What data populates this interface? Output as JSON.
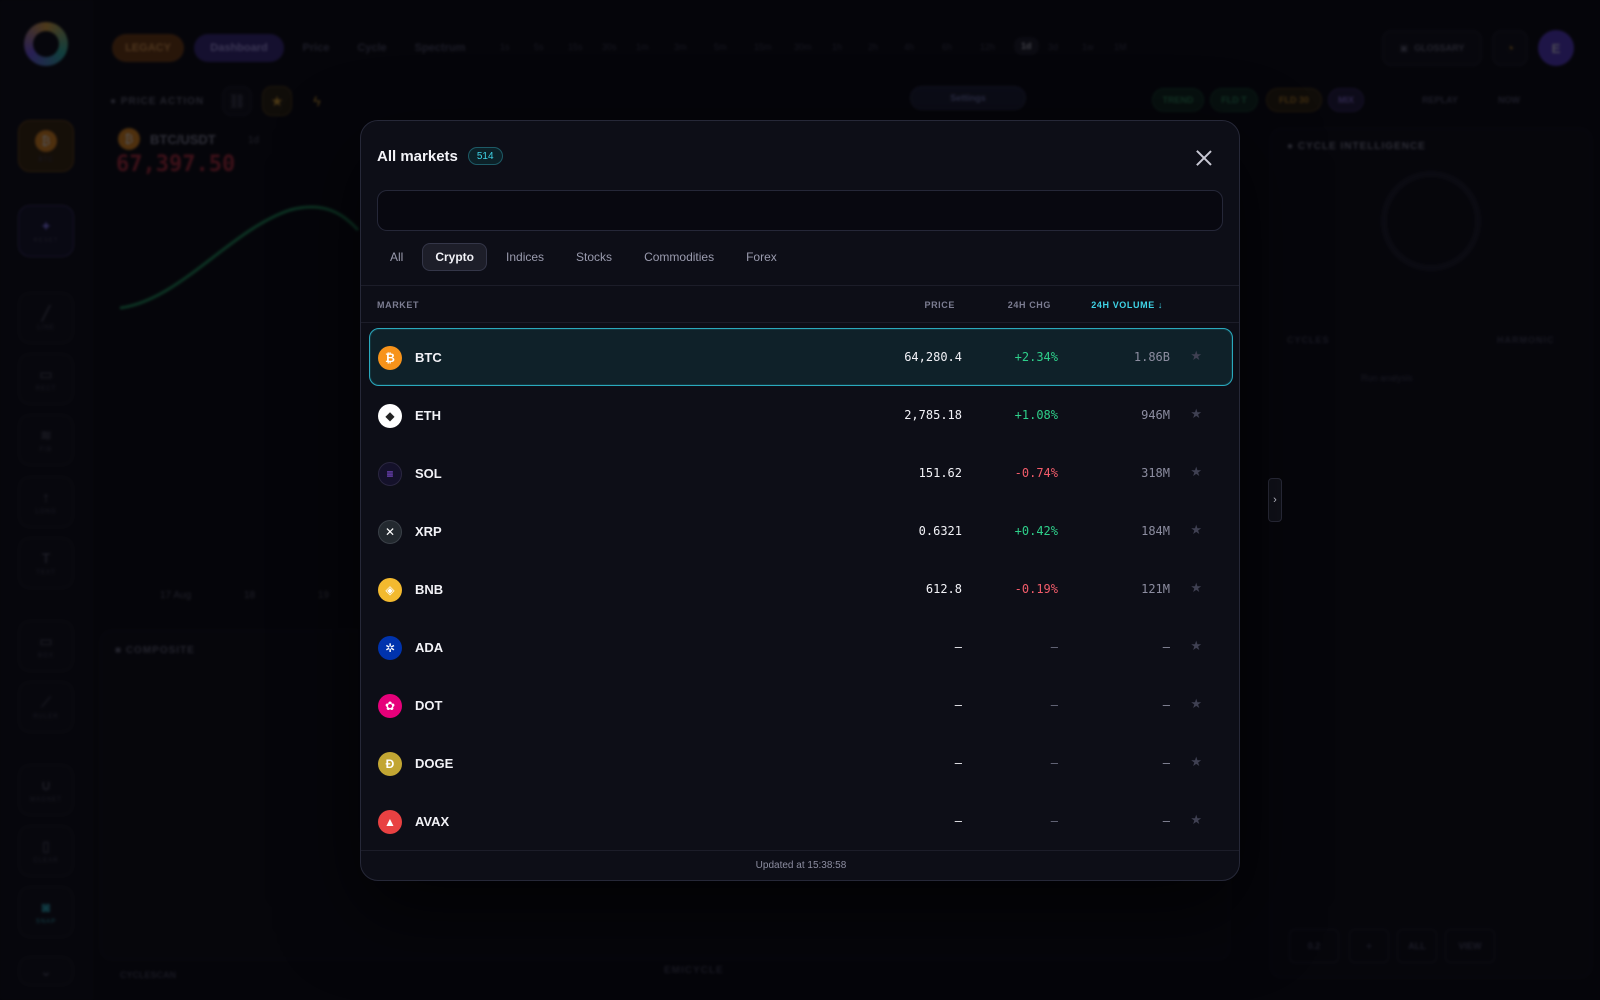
{
  "background": {
    "topbar": {
      "legacy_label": "LEGACY",
      "dashboard_label": "Dashboard",
      "nav": [
        "Price",
        "Cycle",
        "Spectrum"
      ],
      "timeframes": [
        "1s",
        "5s",
        "15s",
        "30s",
        "1m",
        "3m",
        "5m",
        "15m",
        "30m",
        "1h",
        "2h",
        "4h",
        "6h",
        "12h",
        "1d",
        "3d",
        "1w",
        "1M"
      ],
      "active_timeframe": "1d",
      "glossary_label": "GLOSSARY",
      "avatar_initial": "E"
    },
    "sidebar": {
      "btc_label": "BTC",
      "reset_label": "RESET",
      "items": [
        "LINE",
        "RECT",
        "FIB",
        "LONG",
        "TEXT",
        "BOX",
        "RULER",
        "MAGNET",
        "CLEAR",
        "SNAP"
      ]
    },
    "chart": {
      "section_title": "PRICE ACTION",
      "pair": "BTC/USDT",
      "interval": "1d",
      "price": "67,397.50",
      "xticks": [
        "17 Aug",
        "18",
        "19"
      ]
    },
    "toolbar": {
      "settings_label": "Settings",
      "trend_label": "TREND",
      "fld_t_label": "FLD T",
      "fld_30_label": "FLD 30",
      "mix_label": "MIX",
      "replay_label": "REPLAY",
      "now_label": "NOW"
    },
    "composite_title": "COMPOSITE",
    "cycle_intel_title": "CYCLE INTELLIGENCE",
    "cycles_label": "CYCLES",
    "harmonic_label": "HARMONIC",
    "run_analysis_label": "Run analysis",
    "cyclescan_label": "CYCLESCAN",
    "emicycle_label": "EMICYCLE",
    "bottom_buttons": [
      "0.2",
      "+",
      "ALL",
      "VIEW"
    ]
  },
  "modal": {
    "title": "All markets",
    "count": "514",
    "search_placeholder": "",
    "search_value": "",
    "tabs": [
      "All",
      "Crypto",
      "Indices",
      "Stocks",
      "Commodities",
      "Forex"
    ],
    "active_tab": "Crypto",
    "columns": {
      "market": "MARKET",
      "price": "PRICE",
      "change": "24H CHG",
      "volume": "24H VOLUME ↓"
    },
    "rows": [
      {
        "symbol": "BTC",
        "price": "64,280.4",
        "change": "+2.34%",
        "volume": "1.86B",
        "trend": "up",
        "icon": "bitcoin-icon",
        "color": "#f7931a",
        "glyph": "₿"
      },
      {
        "symbol": "ETH",
        "price": "2,785.18",
        "change": "+1.08%",
        "volume": "946M",
        "trend": "up",
        "icon": "ethereum-icon",
        "color": "#ffffff",
        "glyph": "◆"
      },
      {
        "symbol": "SOL",
        "price": "151.62",
        "change": "-0.74%",
        "volume": "318M",
        "trend": "down",
        "icon": "solana-icon",
        "color": "#14112a",
        "glyph": "≡"
      },
      {
        "symbol": "XRP",
        "price": "0.6321",
        "change": "+0.42%",
        "volume": "184M",
        "trend": "up",
        "icon": "xrp-icon",
        "color": "#23292f",
        "glyph": "✕"
      },
      {
        "symbol": "BNB",
        "price": "612.8",
        "change": "-0.19%",
        "volume": "121M",
        "trend": "down",
        "icon": "bnb-icon",
        "color": "#f3ba2f",
        "glyph": "◈"
      },
      {
        "symbol": "ADA",
        "price": "—",
        "change": "—",
        "volume": "—",
        "trend": "none",
        "icon": "cardano-icon",
        "color": "#0033ad",
        "glyph": "✲"
      },
      {
        "symbol": "DOT",
        "price": "—",
        "change": "—",
        "volume": "—",
        "trend": "none",
        "icon": "polkadot-icon",
        "color": "#e6007a",
        "glyph": "✿"
      },
      {
        "symbol": "DOGE",
        "price": "—",
        "change": "—",
        "volume": "—",
        "trend": "none",
        "icon": "dogecoin-icon",
        "color": "#c2a633",
        "glyph": "Ð"
      },
      {
        "symbol": "AVAX",
        "price": "—",
        "change": "—",
        "volume": "—",
        "trend": "none",
        "icon": "avalanche-icon",
        "color": "#e84142",
        "glyph": "▲"
      }
    ],
    "selected_symbol": "BTC",
    "star_glyph": "★",
    "footer": "Updated at 15:38:58"
  }
}
